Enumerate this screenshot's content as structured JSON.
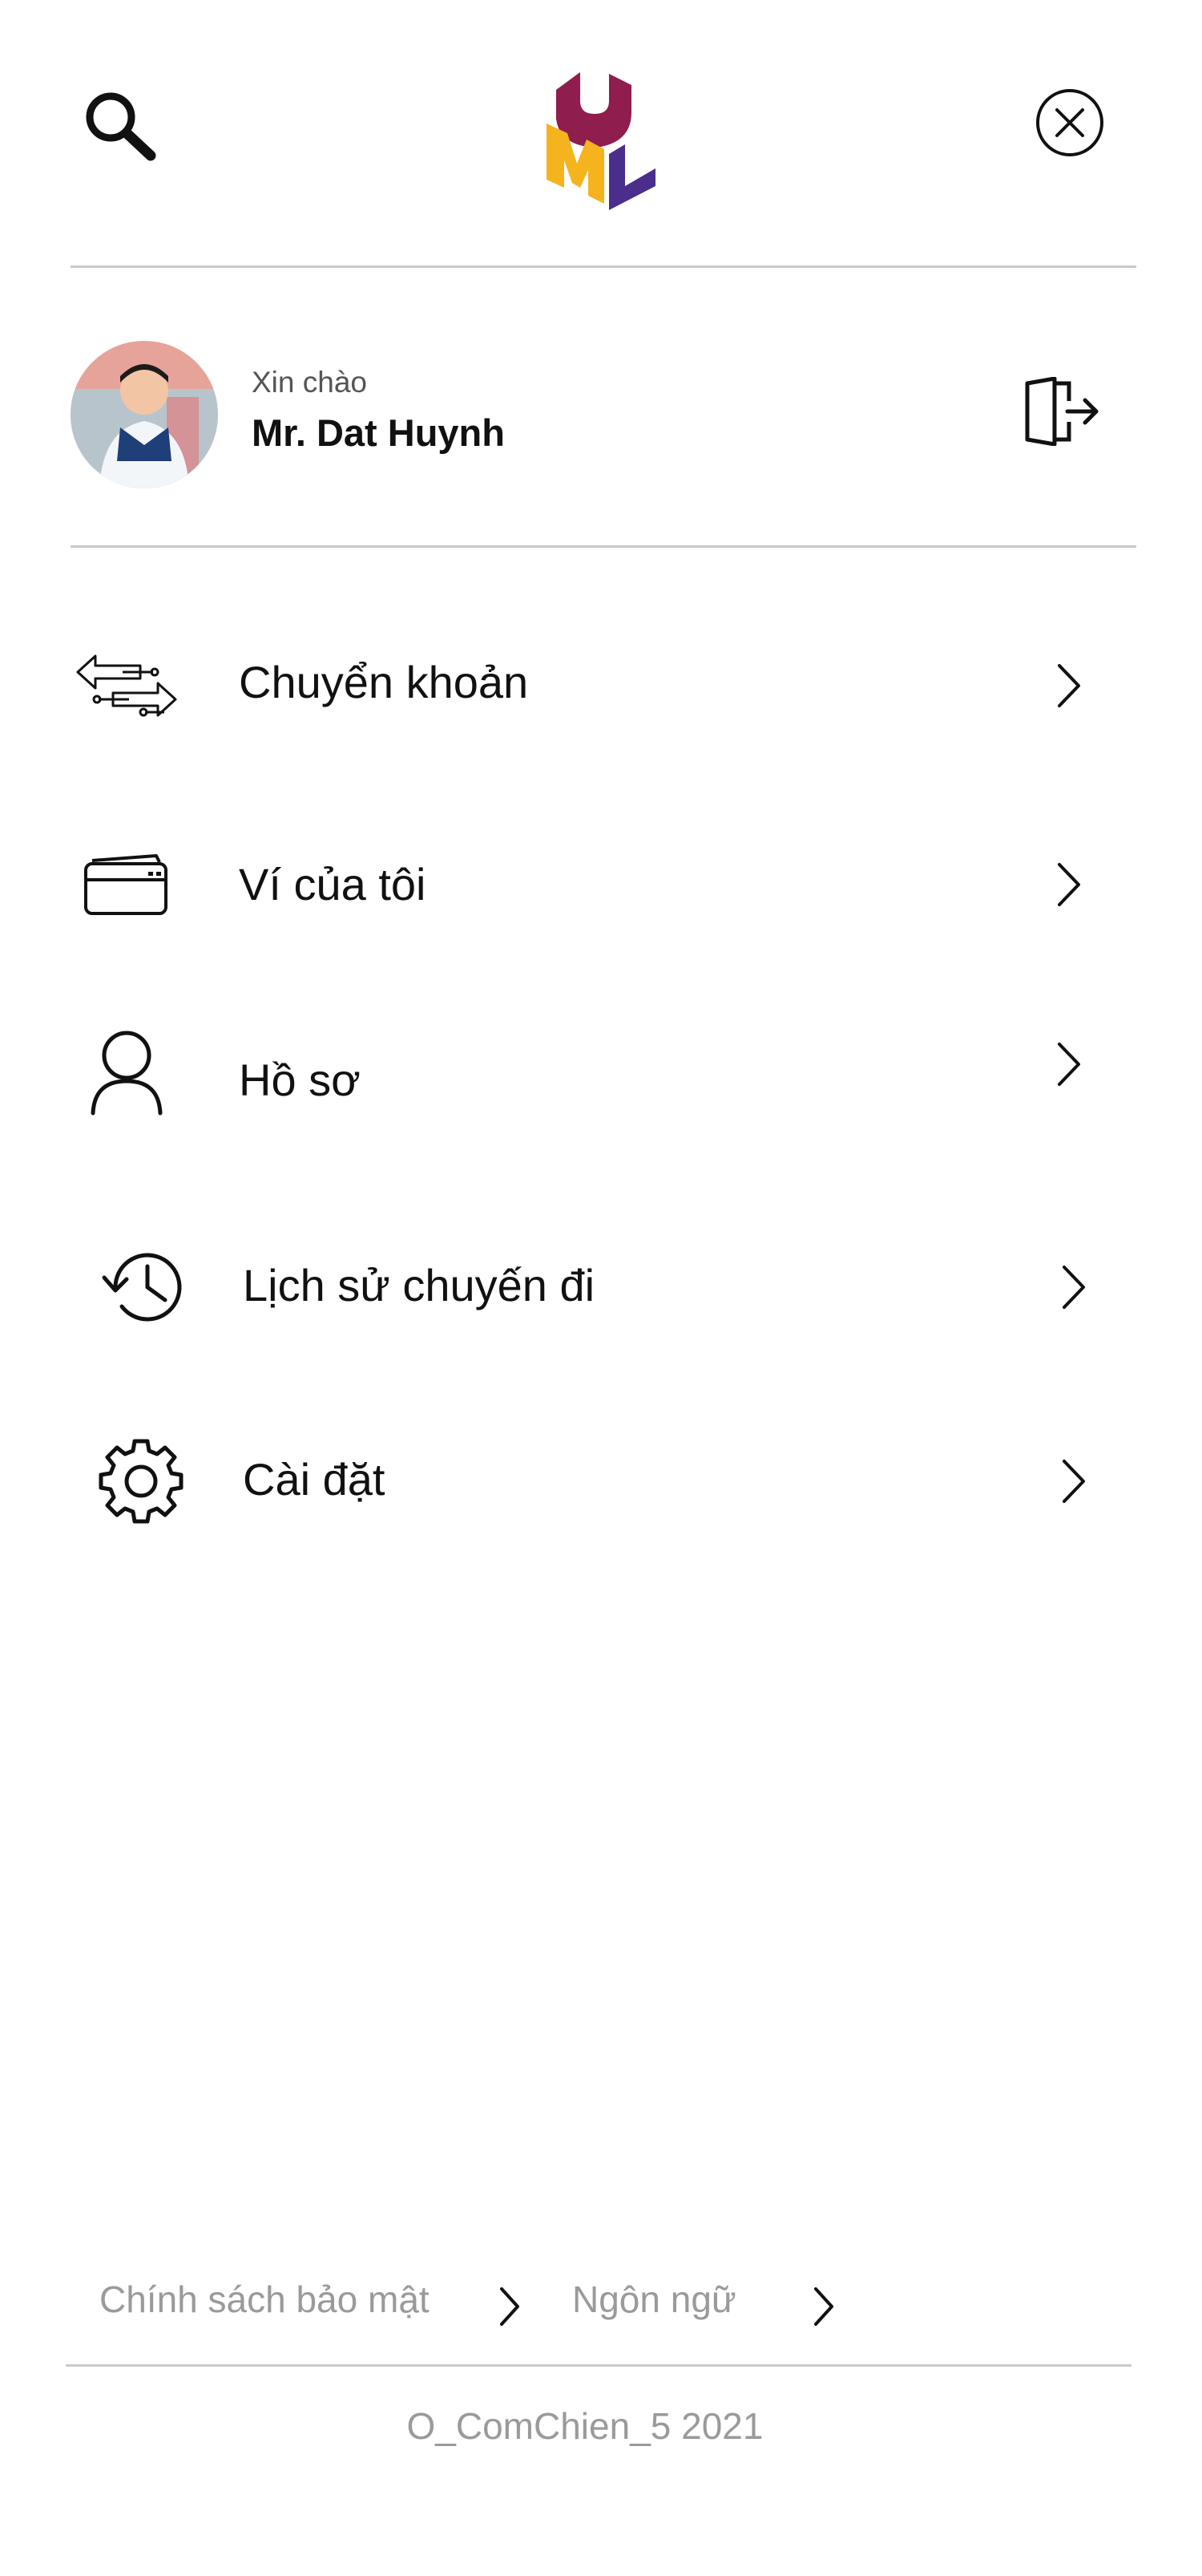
{
  "header": {
    "search_icon": "search-icon",
    "logo": "UML",
    "close_icon": "close-circle-icon",
    "brand_colors": {
      "u": "#8f1d4e",
      "m": "#f5b31d",
      "l": "#4b2e8c"
    }
  },
  "user": {
    "greeting": "Xin chào",
    "name": "Mr. Dat Huynh",
    "logout_icon": "logout-door-icon"
  },
  "menu": {
    "items": [
      {
        "label": "Chuyển khoản",
        "icon": "transfer-arrows-icon"
      },
      {
        "label": "Ví của tôi",
        "icon": "wallet-card-icon"
      },
      {
        "label": "Hồ sơ",
        "icon": "profile-person-icon"
      },
      {
        "label": "Lịch sử chuyến đi",
        "icon": "history-clock-icon"
      },
      {
        "label": "Cài đặt",
        "icon": "settings-gear-icon"
      }
    ]
  },
  "footer": {
    "links": [
      {
        "label": "Chính sách bảo mật"
      },
      {
        "label": "Ngôn ngữ"
      }
    ],
    "copyright": "O_ComChien_5 2021"
  }
}
